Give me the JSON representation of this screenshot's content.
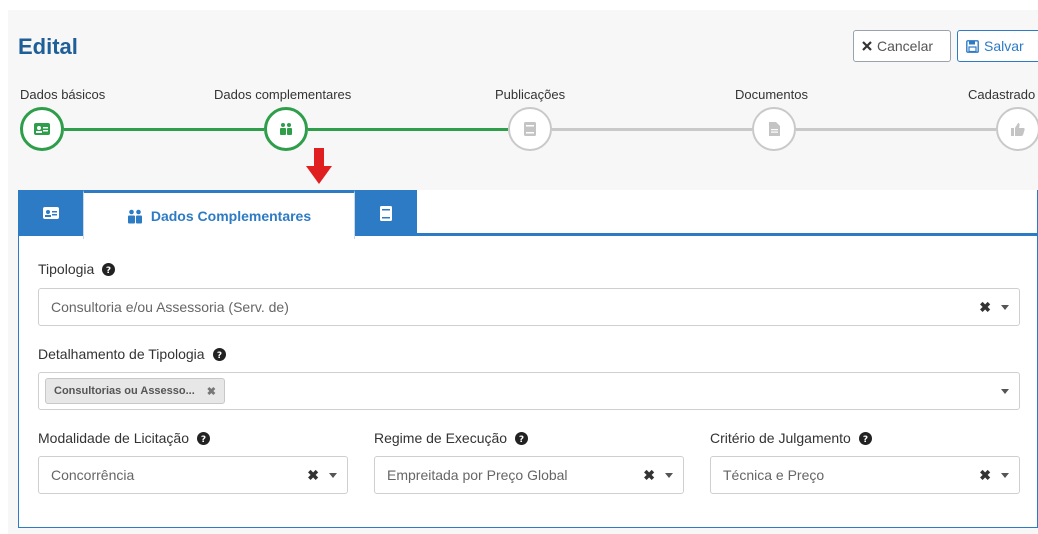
{
  "header": {
    "title": "Edital",
    "cancel_label": "Cancelar",
    "save_label": "Salvar"
  },
  "steps": [
    {
      "label": "Dados básicos",
      "icon": "id-card-icon",
      "status": "done"
    },
    {
      "label": "Dados complementares",
      "icon": "users-icon",
      "status": "done"
    },
    {
      "label": "Publicações",
      "icon": "book-icon",
      "status": "pending"
    },
    {
      "label": "Documentos",
      "icon": "file-icon",
      "status": "pending"
    },
    {
      "label": "Cadastrado",
      "icon": "thumbs-up-icon",
      "status": "pending"
    }
  ],
  "tabs": {
    "active_label": "Dados Complementares",
    "icons": [
      "id-card-icon",
      "users-icon",
      "book-icon"
    ]
  },
  "form": {
    "tipologia_label": "Tipologia",
    "tipologia_value": "Consultoria e/ou Assessoria (Serv. de)",
    "detalhamento_label": "Detalhamento de Tipologia",
    "detalhamento_chip": "Consultorias ou Assesso...",
    "modalidade_label": "Modalidade de Licitação",
    "modalidade_value": "Concorrência",
    "regime_label": "Regime de Execução",
    "regime_value": "Empreitada por Preço Global",
    "criterio_label": "Critério de Julgamento",
    "criterio_value": "Técnica e Preço",
    "clear_symbol": "✖",
    "chip_clear_symbol": "✖"
  },
  "colors": {
    "primary": "#2d7bc4",
    "success": "#2e9e4a",
    "inactive": "#c9c9c9",
    "arrow": "#e02020"
  }
}
